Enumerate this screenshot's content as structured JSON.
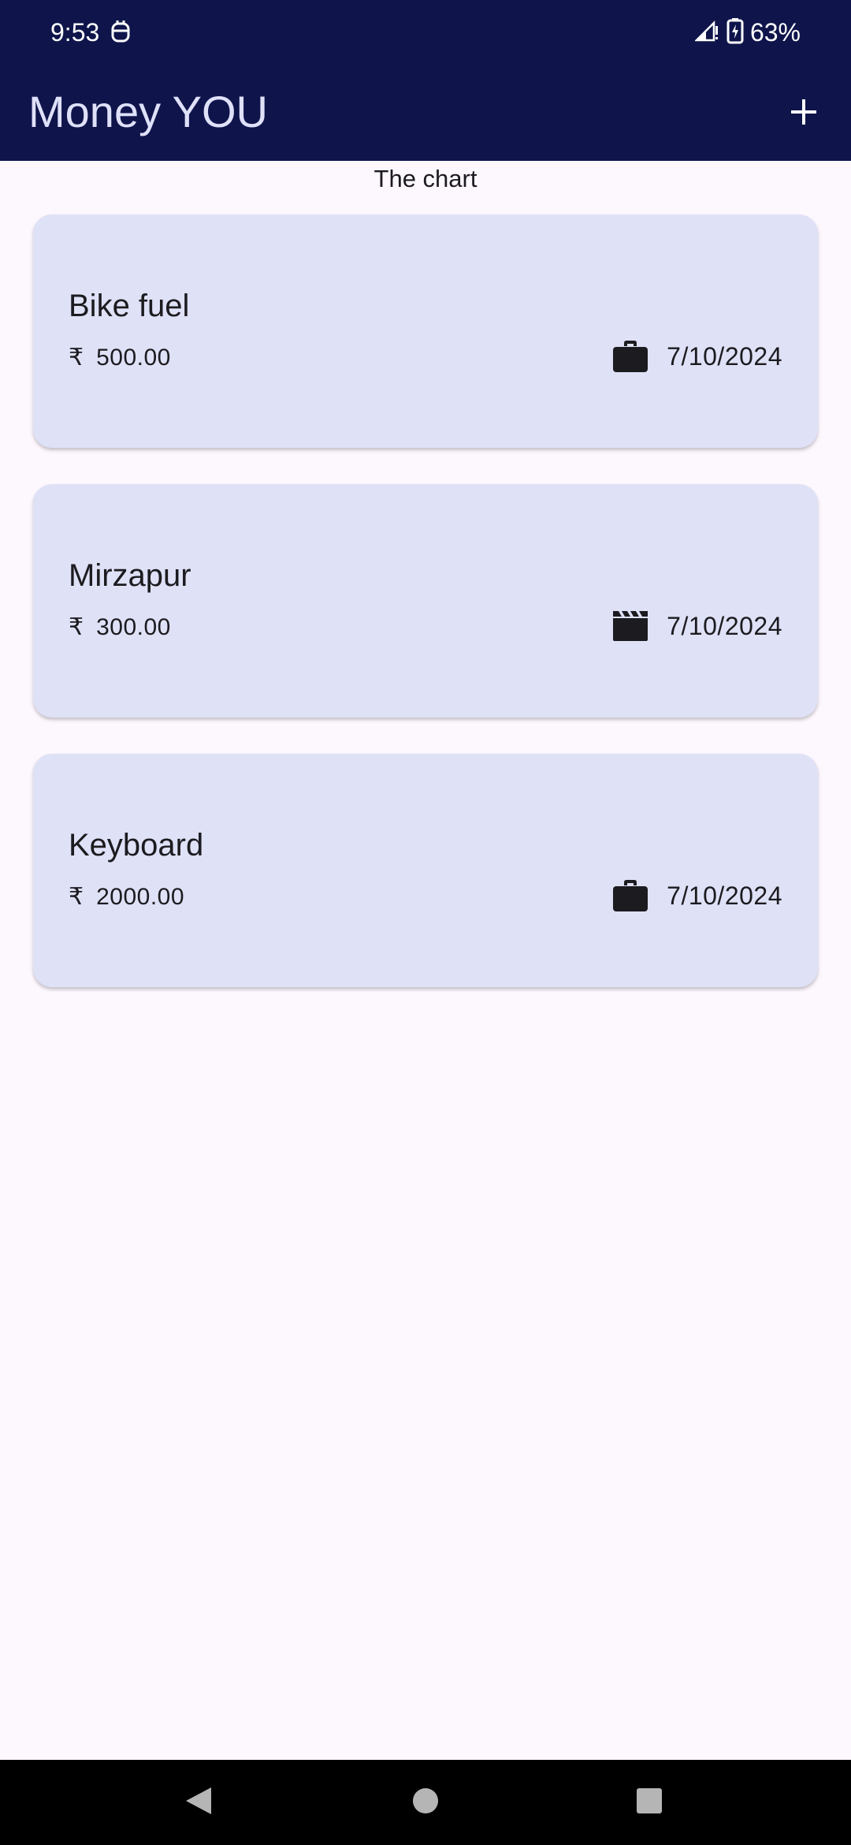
{
  "status_bar": {
    "time": "9:53",
    "battery_percent": "63%",
    "icons": [
      "notification-icon",
      "signal-icon",
      "battery-charging-icon"
    ]
  },
  "app_bar": {
    "title": "Money YOU",
    "add_icon": "plus-icon"
  },
  "chart": {
    "label": "The chart"
  },
  "expenses": [
    {
      "title": "Bike fuel",
      "currency": "₹",
      "amount": "500.00",
      "category_icon": "briefcase-icon",
      "date": "7/10/2024"
    },
    {
      "title": "Mirzapur",
      "currency": "₹",
      "amount": "300.00",
      "category_icon": "movie-icon",
      "date": "7/10/2024"
    },
    {
      "title": "Keyboard",
      "currency": "₹",
      "amount": "2000.00",
      "category_icon": "briefcase-icon",
      "date": "7/10/2024"
    }
  ],
  "nav_bar": {
    "icons": [
      "back-icon",
      "home-icon",
      "recents-icon"
    ]
  },
  "colors": {
    "app_bar": "#0f154b",
    "title_text": "#dfe1f9",
    "card": "#dfe1f7",
    "background": "#fdf7fe",
    "text": "#1c1b1f"
  }
}
